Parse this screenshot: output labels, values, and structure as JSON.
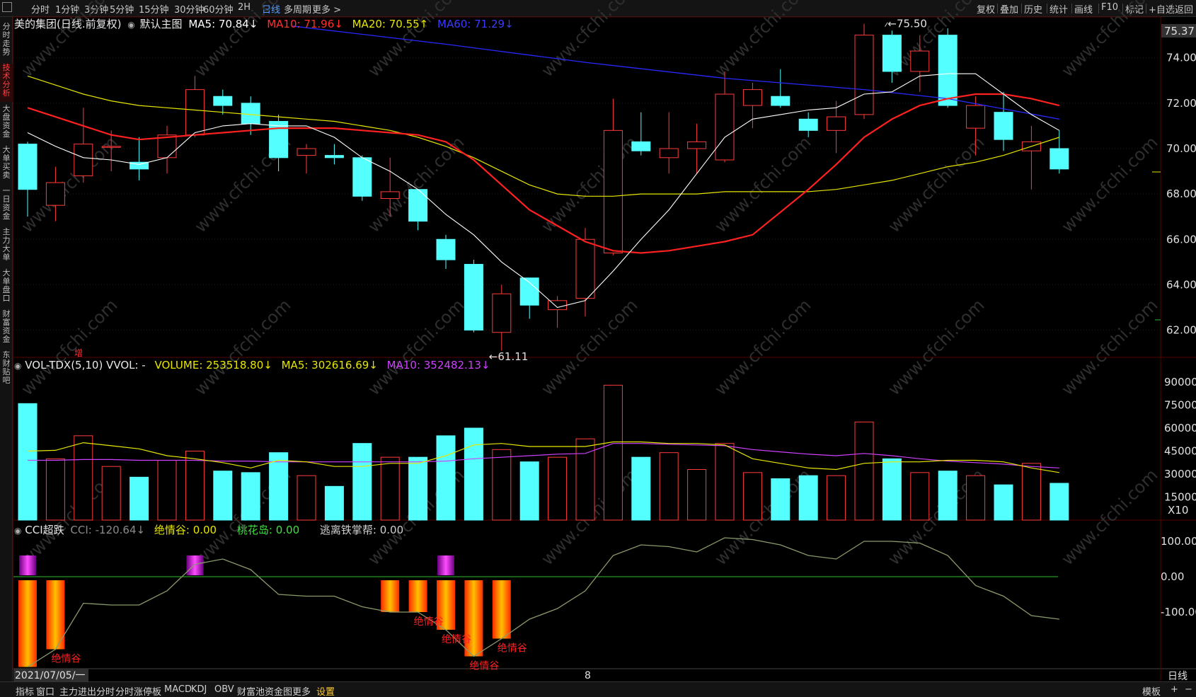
{
  "topbar": {
    "periods": [
      "分时",
      "1分钟",
      "3分钟",
      "5分钟",
      "15分钟",
      "30分钟",
      "60分钟",
      "2H",
      "日线",
      "多周期",
      "更多 >"
    ],
    "active_period": "日线",
    "right_tools": [
      "复权",
      "叠加",
      "历史",
      "统计",
      "画线",
      "F10",
      "标记",
      "+自选",
      "返回"
    ]
  },
  "sidebar": {
    "tabs": [
      "分时走势",
      "技术分析",
      "大盘资金",
      "大单买卖",
      "一日资金",
      "主力大单",
      "大单盘口",
      "财富资金",
      "东财贴吧"
    ],
    "active": "技术分析"
  },
  "legend_main": {
    "title": "美的集团(日线.前复权)",
    "template": "默认主图",
    "ma5": "MA5: 70.84↓",
    "ma10": "MA10: 71.96↓",
    "ma20": "MA20: 70.55↑",
    "ma60": "MA60: 71.29↓"
  },
  "legend_vol": {
    "name": "VOL-TDX(5,10) VVOL: -",
    "volume": "VOLUME: 253518.80↓",
    "ma5": "MA5: 302616.69↓",
    "ma10": "MA10: 352482.13↓"
  },
  "legend_cci": {
    "name": "CCI超跌",
    "cci": "CCI: -120.64↓",
    "jqg": "绝情谷: 0.00",
    "thd": "桃花岛: 0.00",
    "tl": "逃离铁掌帮: 0.00"
  },
  "annotations": {
    "high": "75.50",
    "low": "61.11",
    "zeng": "增",
    "valley": "绝情谷"
  },
  "axis": {
    "price_top": "75.37",
    "vol_unit": "X10",
    "date_left": "2021/07/05/一",
    "month_mark": "8",
    "period_label": "日线"
  },
  "watermark": "www.cfchi.com",
  "bottombar": {
    "tabs": [
      "指标",
      "窗口",
      "主力进出分时",
      "分时涨停板",
      "MACD",
      "KDJ",
      "OBV",
      "财富池资金图",
      "更多",
      "设置"
    ],
    "active": "设置",
    "right": [
      "模板",
      "+",
      "−"
    ]
  },
  "colors": {
    "up": "#ff3b3b",
    "down": "#54ffff",
    "ma5": "#ffffff",
    "ma10": "#ff2020",
    "ma20": "#e6e600",
    "ma60": "#2828ff",
    "vol_ma5": "#e6e600",
    "vol_ma10": "#d040ff",
    "cci": "#8a9a6a",
    "grid": "#5a0000"
  },
  "chart_data": {
    "type": "candlestick",
    "price_ylim": [
      60.8,
      75.8
    ],
    "price_ticks": [
      62,
      64,
      66,
      68,
      70,
      72,
      74
    ],
    "vol_ticks": [
      15000,
      30000,
      45000,
      60000,
      75000,
      90000
    ],
    "vol_ylim": [
      0,
      90000
    ],
    "cci_ticks": [
      -100,
      0,
      100
    ],
    "cci_ylim": [
      -260,
      160
    ],
    "candles": [
      [
        70.2,
        68.2,
        70.3,
        67.0
      ],
      [
        67.5,
        68.5,
        69.2,
        66.8
      ],
      [
        68.8,
        70.2,
        71.8,
        68.5
      ],
      [
        70.1,
        70.1,
        70.8,
        69.0
      ],
      [
        69.4,
        69.1,
        70.5,
        68.6
      ],
      [
        69.6,
        70.6,
        71.0,
        68.9
      ],
      [
        70.6,
        72.6,
        73.2,
        70.5
      ],
      [
        72.3,
        71.9,
        72.6,
        71.5
      ],
      [
        72.0,
        71.1,
        72.3,
        70.6
      ],
      [
        71.2,
        69.6,
        71.5,
        69.0
      ],
      [
        69.7,
        70.0,
        70.2,
        68.9
      ],
      [
        69.7,
        69.6,
        70.2,
        69.3
      ],
      [
        69.6,
        67.9,
        69.7,
        67.7
      ],
      [
        67.8,
        68.1,
        69.6,
        67.0
      ],
      [
        68.2,
        66.8,
        68.2,
        66.4
      ],
      [
        66.0,
        65.1,
        66.2,
        64.7
      ],
      [
        64.9,
        62.0,
        65.1,
        61.9
      ],
      [
        61.9,
        63.6,
        64.0,
        61.1
      ],
      [
        64.3,
        63.1,
        64.3,
        62.5
      ],
      [
        62.9,
        63.3,
        63.5,
        62.1
      ],
      [
        63.4,
        66.0,
        66.5,
        62.6
      ],
      [
        65.4,
        70.8,
        72.2,
        65.3
      ],
      [
        70.3,
        69.9,
        71.6,
        69.7
      ],
      [
        69.6,
        70.0,
        71.6,
        68.9
      ],
      [
        70.0,
        70.3,
        71.1,
        68.9
      ],
      [
        69.5,
        72.4,
        73.4,
        69.4
      ],
      [
        71.9,
        72.6,
        72.9,
        70.9
      ],
      [
        72.3,
        71.9,
        73.5,
        71.8
      ],
      [
        71.3,
        70.8,
        71.6,
        70.5
      ],
      [
        70.8,
        71.4,
        72.1,
        69.8
      ],
      [
        71.5,
        75.0,
        75.5,
        71.3
      ],
      [
        75.0,
        73.4,
        75.2,
        72.9
      ],
      [
        73.4,
        74.3,
        75.0,
        72.5
      ],
      [
        75.0,
        71.9,
        75.3,
        71.8
      ],
      [
        70.9,
        71.9,
        72.3,
        69.7
      ],
      [
        71.6,
        70.4,
        72.5,
        69.9
      ],
      [
        69.9,
        70.3,
        71.0,
        68.2
      ],
      [
        70.0,
        69.1,
        70.8,
        68.9
      ]
    ],
    "ma5": [
      70.7,
      70.1,
      69.6,
      69.5,
      69.3,
      69.6,
      70.7,
      71.0,
      71.1,
      71.0,
      71.0,
      70.5,
      69.6,
      69.0,
      68.2,
      67.1,
      66.2,
      65.0,
      64.1,
      63.0,
      63.3,
      64.6,
      66.0,
      67.3,
      68.9,
      70.5,
      71.3,
      71.5,
      71.7,
      71.8,
      72.4,
      72.5,
      73.2,
      73.3,
      73.3,
      72.4,
      71.5,
      70.8
    ],
    "ma10": [
      71.8,
      71.4,
      71.0,
      70.6,
      70.4,
      70.5,
      70.6,
      70.7,
      70.8,
      70.9,
      70.9,
      70.9,
      70.8,
      70.7,
      70.6,
      70.3,
      69.5,
      68.4,
      67.3,
      66.6,
      65.9,
      65.5,
      65.4,
      65.5,
      65.7,
      65.9,
      66.2,
      67.2,
      68.2,
      69.3,
      70.5,
      71.3,
      71.9,
      72.2,
      72.4,
      72.4,
      72.2,
      71.9
    ],
    "ma20": [
      73.2,
      72.8,
      72.4,
      72.1,
      71.9,
      71.8,
      71.7,
      71.6,
      71.5,
      71.4,
      71.3,
      71.2,
      71.0,
      70.8,
      70.5,
      70.1,
      69.6,
      69.0,
      68.4,
      68.0,
      67.9,
      67.9,
      68.0,
      68.0,
      68.0,
      68.1,
      68.1,
      68.1,
      68.1,
      68.2,
      68.4,
      68.6,
      68.9,
      69.2,
      69.4,
      69.7,
      70.1,
      70.5
    ],
    "ma60": {
      "x": [
        9.5,
        15,
        20,
        25,
        30,
        33,
        37
      ],
      "y": [
        75.4,
        74.6,
        73.8,
        73.1,
        72.6,
        72.2,
        71.3
      ]
    },
    "volume": [
      76000,
      40000,
      55000,
      35000,
      28000,
      39000,
      45000,
      32000,
      31000,
      44000,
      29000,
      22000,
      50000,
      41000,
      41000,
      55000,
      60000,
      46000,
      38000,
      41000,
      53000,
      88000,
      41000,
      44000,
      33000,
      50000,
      31000,
      27000,
      29000,
      29000,
      64000,
      40000,
      31000,
      32000,
      29000,
      23000,
      37000,
      24000
    ],
    "vol_ma5": [
      45000,
      45500,
      50500,
      48500,
      46500,
      42000,
      40000,
      37500,
      34000,
      39000,
      38000,
      35000,
      35000,
      37000,
      37000,
      42000,
      49000,
      50000,
      48000,
      48000,
      48000,
      51000,
      51000,
      50000,
      50000,
      49000,
      40000,
      37000,
      34000,
      33000,
      37000,
      38000,
      38000,
      39000,
      39000,
      38000,
      34000,
      31000
    ],
    "vol_ma10": [
      39000,
      39000,
      39500,
      39500,
      39000,
      39000,
      39000,
      38500,
      38500,
      38000,
      38000,
      38000,
      38000,
      38000,
      38000,
      38500,
      40000,
      41000,
      42000,
      43000,
      43500,
      50000,
      50000,
      49500,
      49000,
      48500,
      46000,
      44500,
      43000,
      42000,
      43500,
      42000,
      40000,
      38500,
      37500,
      36500,
      35000,
      34000
    ],
    "cci": [
      -255,
      -205,
      -75,
      -80,
      -80,
      -40,
      35,
      50,
      20,
      -50,
      -55,
      -55,
      -85,
      -100,
      -100,
      -150,
      -225,
      -175,
      -120,
      -90,
      -40,
      60,
      90,
      85,
      70,
      110,
      105,
      90,
      60,
      50,
      100,
      100,
      95,
      60,
      -25,
      -55,
      -110,
      -120
    ],
    "zeng_idx": [
      0,
      1,
      13,
      14,
      15,
      16,
      17
    ],
    "purple_idx": [
      0,
      6,
      15
    ]
  }
}
